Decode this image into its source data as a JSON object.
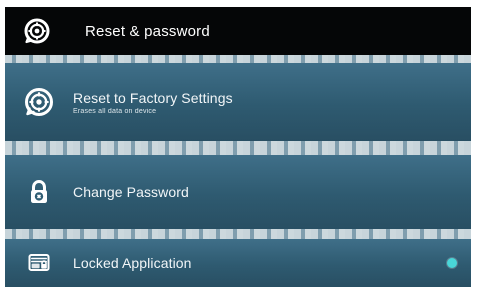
{
  "titlebar": {
    "title": "Reset & password",
    "icon": "reset-gear-icon"
  },
  "items": [
    {
      "label": "Reset to Factory Settings",
      "sublabel": "Erases all data on device",
      "icon": "reset-gear-icon"
    },
    {
      "label": "Change Password",
      "icon": "lock-icon"
    },
    {
      "label": "Locked Application",
      "icon": "app-lock-icon",
      "status_dot_color": "#49d6d8"
    }
  ],
  "colors": {
    "titlebar_bg": "#050607",
    "screen_bg": "#2f5d73",
    "accent_dot": "#49d6d8"
  }
}
